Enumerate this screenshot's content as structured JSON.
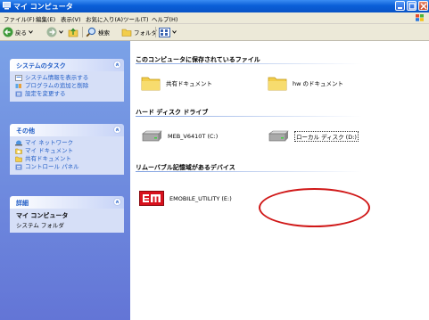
{
  "window": {
    "title": "マイ コンピュータ"
  },
  "menu": [
    "ファイル(F)",
    "編集(E)",
    "表示(V)",
    "お気に入り(A)",
    "ツール(T)",
    "ヘルプ(H)"
  ],
  "toolbar": {
    "back_label": "戻る",
    "search_label": "検索",
    "folders_label": "フォルダ"
  },
  "tasks": {
    "system": {
      "title": "システムのタスク",
      "items": [
        "システム情報を表示する",
        "プログラムの追加と削除",
        "設定を変更する"
      ]
    },
    "other": {
      "title": "その他",
      "items": [
        "マイ ネットワーク",
        "マイ ドキュメント",
        "共有ドキュメント",
        "コントロール パネル"
      ]
    },
    "details": {
      "title": "詳細",
      "name": "マイ コンピュータ",
      "type": "システム フォルダ"
    }
  },
  "main": {
    "stored_files": {
      "title": "このコンピュータに保存されているファイル",
      "items": [
        "共有ドキュメント",
        "hw のドキュメント"
      ]
    },
    "hard_disks": {
      "title": "ハード ディスク ドライブ",
      "items": [
        "MEB_V6410T (C:)",
        "ローカル ディスク (D:)"
      ]
    },
    "removable": {
      "title": "リムーバブル記憶域があるデバイス",
      "items": [
        "EMOBILE_UTILITY (E:)"
      ],
      "logo_text": "em"
    }
  },
  "colors": {
    "highlight_circle": "#d01818",
    "emobile_logo": "#d8101c",
    "titlebar": "#0a5fd8"
  }
}
